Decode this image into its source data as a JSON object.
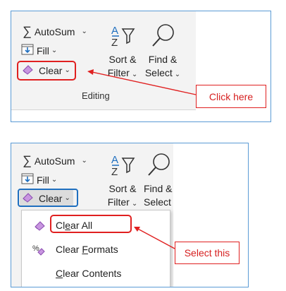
{
  "panel_top": {
    "autosum_label": "AutoSum",
    "fill_label": "Fill",
    "clear_label": "Clear",
    "sort_filter_line1": "Sort &",
    "sort_filter_line2": "Filter",
    "find_select_line1": "Find &",
    "find_select_line2": "Select",
    "group_label": "Editing",
    "callout_text": "Click here"
  },
  "panel_bottom": {
    "autosum_label": "AutoSum",
    "fill_label": "Fill",
    "clear_label": "Clear",
    "sort_filter_line1": "Sort &",
    "sort_filter_line2": "Filter",
    "find_select_line1": "Find &",
    "find_select_line2": "Select",
    "menu": {
      "clear_all": {
        "pre": "Cl",
        "accel": "e",
        "post": "ar All"
      },
      "clear_formats": {
        "pre": "Clear ",
        "accel": "F",
        "post": "ormats"
      },
      "clear_contents": {
        "pre": "",
        "accel": "C",
        "post": "lear Contents"
      }
    },
    "callout_text": "Select this"
  },
  "icons": [
    "sigma-icon",
    "fill-down-icon",
    "eraser-icon",
    "sort-filter-icon",
    "find-magnifier-icon",
    "percent-eraser-icon"
  ],
  "colors": {
    "frame": "#5b9bd5",
    "highlight_red": "#e02020",
    "highlight_blue": "#1f6fbf",
    "ribbon_bg": "#f3f3f3"
  }
}
